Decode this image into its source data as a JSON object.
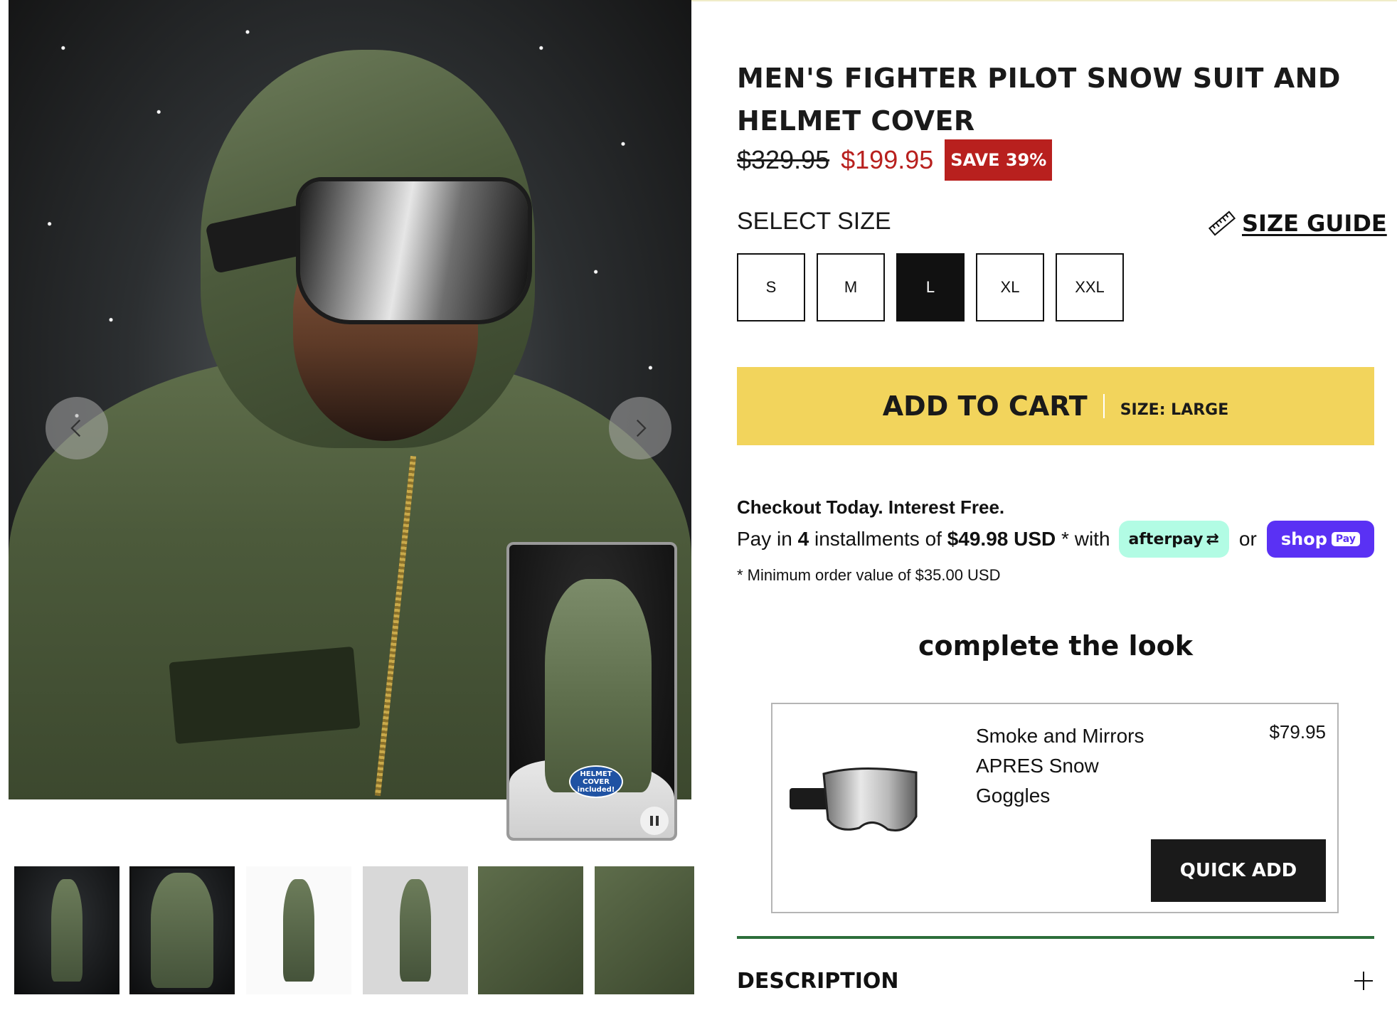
{
  "gallery": {
    "prev_icon": "chevron-left-icon",
    "next_icon": "chevron-right-icon",
    "video": {
      "badge_lines": [
        "HELMET",
        "COVER",
        "included!"
      ],
      "pause_icon": "pause-icon"
    },
    "thumbnails": [
      {
        "name": "thumb-1",
        "style": "dark"
      },
      {
        "name": "thumb-2",
        "style": "dark",
        "active": true
      },
      {
        "name": "thumb-3",
        "style": "light"
      },
      {
        "name": "thumb-4",
        "style": "grey"
      },
      {
        "name": "thumb-5",
        "style": "close"
      },
      {
        "name": "thumb-6",
        "style": "close"
      }
    ]
  },
  "product": {
    "title": "MEN'S FIGHTER PILOT SNOW SUIT AND HELMET COVER",
    "price_original": "$329.95",
    "price_sale": "$199.95",
    "save_badge": "SAVE 39%",
    "sale_color": "#b8201e"
  },
  "size_selector": {
    "label": "SELECT SIZE",
    "guide_label": "SIZE GUIDE",
    "guide_icon": "ruler-icon",
    "sizes": [
      "S",
      "M",
      "L",
      "XL",
      "XXL"
    ],
    "selected": "L"
  },
  "cart": {
    "button_label": "ADD TO CART",
    "size_text": "SIZE: LARGE",
    "button_color": "#f2d45c"
  },
  "checkout": {
    "heading": "Checkout Today. Interest Free.",
    "pay_in": "Pay in",
    "count": "4",
    "installments_of": "installments of",
    "amount": "$49.98 USD",
    "with": "* with",
    "afterpay_label": "afterpay",
    "or": "or",
    "shoppay_label": "shop",
    "shoppay_chip": "Pay",
    "minimum": "* Minimum order value of $35.00 USD"
  },
  "complete_look": {
    "heading": "complete the look",
    "item": {
      "name_lines": [
        "Smoke and Mirrors",
        "APRES Snow",
        "Goggles"
      ],
      "price": "$79.95",
      "quick_add_label": "QUICK ADD"
    }
  },
  "accordion": {
    "description_label": "DESCRIPTION",
    "rule_color": "#2c6e3a"
  }
}
